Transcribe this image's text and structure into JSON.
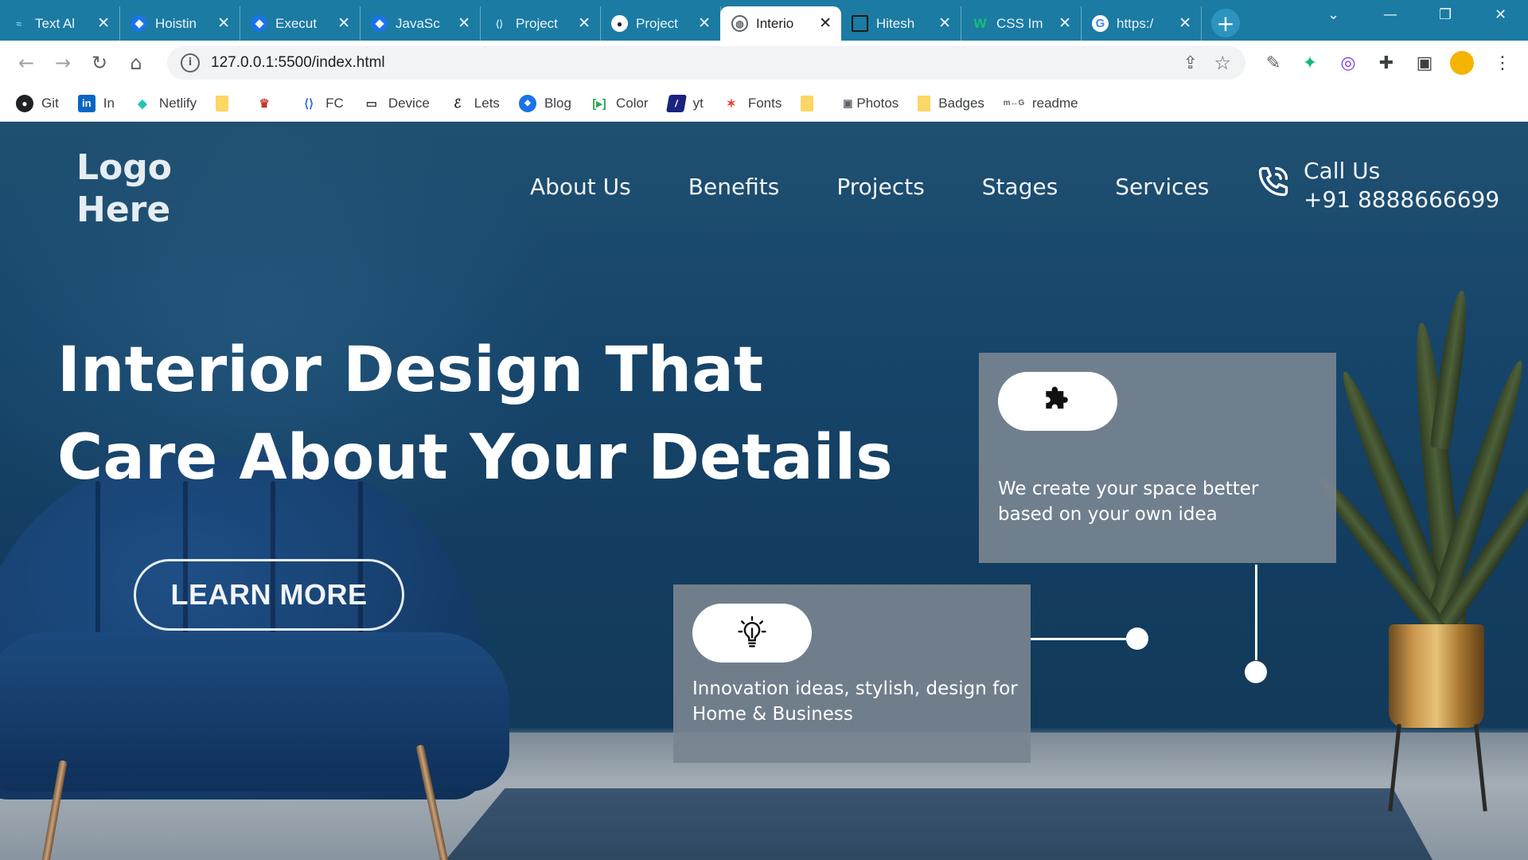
{
  "browser": {
    "tabs": [
      {
        "title": "Text Al",
        "favicon": "tailwind-icon",
        "color": "#38bdf8"
      },
      {
        "title": "Hoistin",
        "favicon": "blue-diamond-icon",
        "color": "#1a73e8"
      },
      {
        "title": "Execut",
        "favicon": "blue-diamond-icon",
        "color": "#1a73e8"
      },
      {
        "title": "JavaSc",
        "favicon": "blue-diamond-icon",
        "color": "#1a73e8"
      },
      {
        "title": "Project",
        "favicon": "vscode-icon",
        "color": "#4ea0e6"
      },
      {
        "title": "Project",
        "favicon": "github-icon",
        "color": "#202124"
      },
      {
        "title": "Interio",
        "favicon": "globe-icon",
        "color": "#5f6368",
        "active": true
      },
      {
        "title": "Hitesh",
        "favicon": "square-icon",
        "color": "#202124"
      },
      {
        "title": "CSS Im",
        "favicon": "w-icon",
        "color": "#0e9f6e"
      },
      {
        "title": "https:/",
        "favicon": "google-icon",
        "color": "#4285f4"
      }
    ],
    "url": "127.0.0.1:5500/index.html",
    "bookmarks": [
      {
        "label": "Git",
        "icon": "github-icon"
      },
      {
        "label": "In",
        "icon": "linkedin-icon"
      },
      {
        "label": "Netlify",
        "icon": "netlify-icon"
      },
      {
        "label": "",
        "icon": "folder-icon"
      },
      {
        "label": "",
        "icon": "app-icon"
      },
      {
        "label": "FC",
        "icon": "code-icon"
      },
      {
        "label": "Device",
        "icon": "device-icon"
      },
      {
        "label": "Lets",
        "icon": "lets-icon"
      },
      {
        "label": "Blog",
        "icon": "blue-diamond-icon"
      },
      {
        "label": "Color",
        "icon": "color-icon"
      },
      {
        "label": "yt",
        "icon": "yt-icon"
      },
      {
        "label": "Fonts",
        "icon": "fonts-icon"
      },
      {
        "label": "",
        "icon": "folder-icon"
      },
      {
        "label": "Photos",
        "icon": "camera-icon"
      },
      {
        "label": "Badges",
        "icon": "folder-icon"
      },
      {
        "label": "readme",
        "icon": "readme-icon"
      }
    ],
    "readme_badge": "m↔G",
    "colors": {
      "tabbar": "#1b7ba3",
      "toolbar": "#ffffff"
    }
  },
  "site": {
    "logo": {
      "line1": "Logo",
      "line2": "Here"
    },
    "nav": [
      "About Us",
      "Benefits",
      "Projects",
      "Stages",
      "Services"
    ],
    "call": {
      "title": "Call Us",
      "number": "+91 8888666699"
    },
    "hero": {
      "line1": "Interior Design That",
      "line2": "Care About Your Details",
      "button": "LEARN MORE"
    },
    "cards": [
      {
        "icon": "puzzle-icon",
        "text": "We create your space better based on your own idea"
      },
      {
        "icon": "lightbulb-icon",
        "text": "Innovation ideas, stylish, design for Home & Business"
      }
    ],
    "colors": {
      "background": "#17456a",
      "card": "#788490",
      "text": "#ffffff"
    }
  }
}
